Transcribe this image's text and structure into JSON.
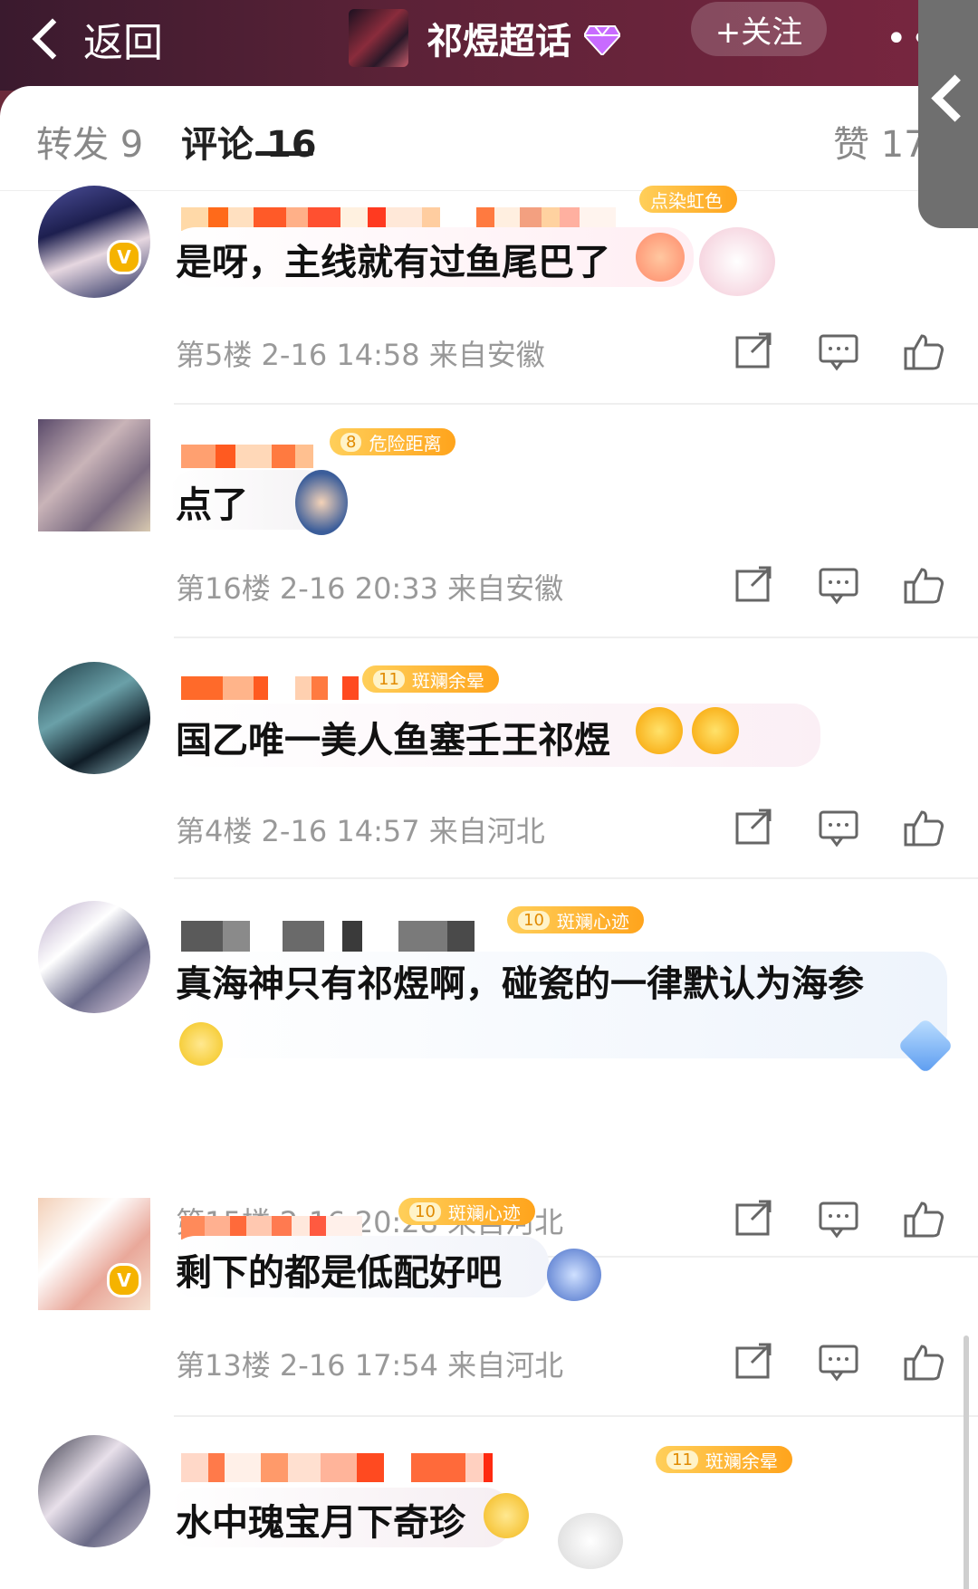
{
  "header": {
    "back_label": "返回",
    "topic_title": "祁煜超话",
    "follow_label": "+关注",
    "more_dots": "••"
  },
  "tabs": {
    "repost": "转发 9",
    "comment": "评论 16",
    "like": "赞 17"
  },
  "comments": [
    {
      "text": "是呀，主线就有过鱼尾巴了",
      "medal": "点染虹色",
      "medal_level": "",
      "floor": "第5楼",
      "time": "2-16 14:58",
      "location": "来自安徽"
    },
    {
      "text": "点了",
      "medal": "危险距离",
      "medal_level": "8",
      "floor": "第16楼",
      "time": "2-16 20:33",
      "location": "来自安徽"
    },
    {
      "text": "国乙唯一美人鱼塞壬王祁煜",
      "medal": "斑斓余晕",
      "medal_level": "11",
      "floor": "第4楼",
      "time": "2-16 14:57",
      "location": "来自河北"
    },
    {
      "text": "真海神只有祁煜啊，碰瓷的一律默认为海参",
      "medal": "斑斓心迹",
      "medal_level": "10",
      "floor": "第15楼",
      "time": "2-16 20:28",
      "location": "来自河北"
    },
    {
      "text": "剩下的都是低配好吧",
      "medal": "斑斓心迹",
      "medal_level": "10",
      "floor": "第13楼",
      "time": "2-16 17:54",
      "location": "来自河北"
    },
    {
      "text": "水中瑰宝月下奇珍",
      "medal": "斑斓余晕",
      "medal_level": "11",
      "floor": "",
      "time": "",
      "location": ""
    }
  ],
  "icons": {
    "back": "chevron-left-icon",
    "gem": "diamond-icon",
    "forward": "share-icon",
    "reply": "comment-icon",
    "like": "thumbs-up-icon",
    "verified": "verified-badge-icon"
  },
  "colors": {
    "header_bg": "#5b2237",
    "medal_gold": "#ffa41c",
    "meta_gray": "#999999"
  }
}
